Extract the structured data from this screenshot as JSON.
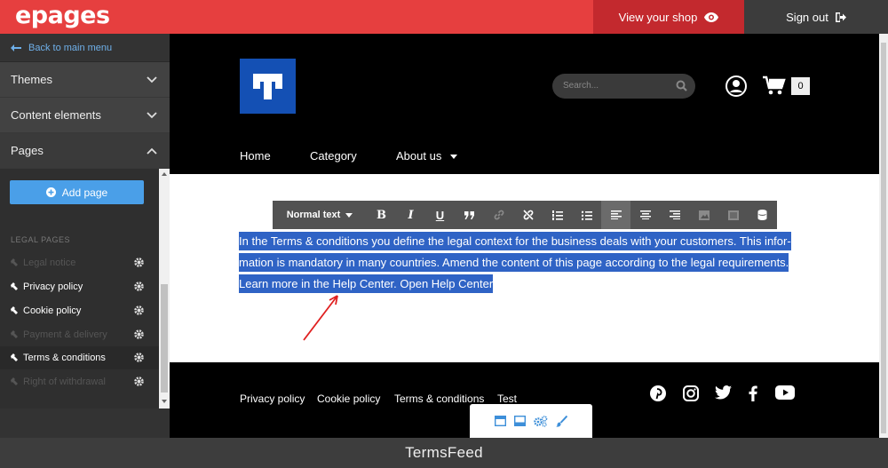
{
  "topbar": {
    "logo": "epages",
    "view_shop": "View your shop",
    "sign_out": "Sign out"
  },
  "sidebar": {
    "back": "Back to main menu",
    "sections": [
      {
        "label": "Themes"
      },
      {
        "label": "Content elements"
      },
      {
        "label": "Pages"
      }
    ],
    "add_page": "Add page",
    "legal_heading": "LEGAL PAGES",
    "legal_pages": [
      {
        "label": "Legal notice",
        "state": "dim"
      },
      {
        "label": "Privacy policy",
        "state": "normal"
      },
      {
        "label": "Cookie policy",
        "state": "normal"
      },
      {
        "label": "Payment & delivery",
        "state": "dim"
      },
      {
        "label": "Terms & conditions",
        "state": "active"
      },
      {
        "label": "Right of withdrawal",
        "state": "dim"
      }
    ]
  },
  "shop": {
    "search_placeholder": "Search...",
    "cart_count": "0",
    "nav": [
      "Home",
      "Category",
      "About us"
    ],
    "editor": {
      "format_label": "Normal text",
      "lines": [
        "In the Terms & conditions you define the legal context for the business deals with your customers. This infor-",
        "mation is mandatory in many countries. Amend the content of this page according to the legal requirements.",
        "Learn more in the Help Center. Open Help Center"
      ]
    },
    "footer_links": [
      "Privacy policy",
      "Cookie policy",
      "Terms & conditions",
      "Test"
    ],
    "social": [
      "pinterest-icon",
      "instagram-icon",
      "twitter-icon",
      "facebook-icon",
      "youtube-icon"
    ]
  },
  "watermark": "TermsFeed",
  "colors": {
    "brand_red": "#e63f3f",
    "accent_blue": "#4a9fe8",
    "selection_blue": "#2f63c5"
  }
}
